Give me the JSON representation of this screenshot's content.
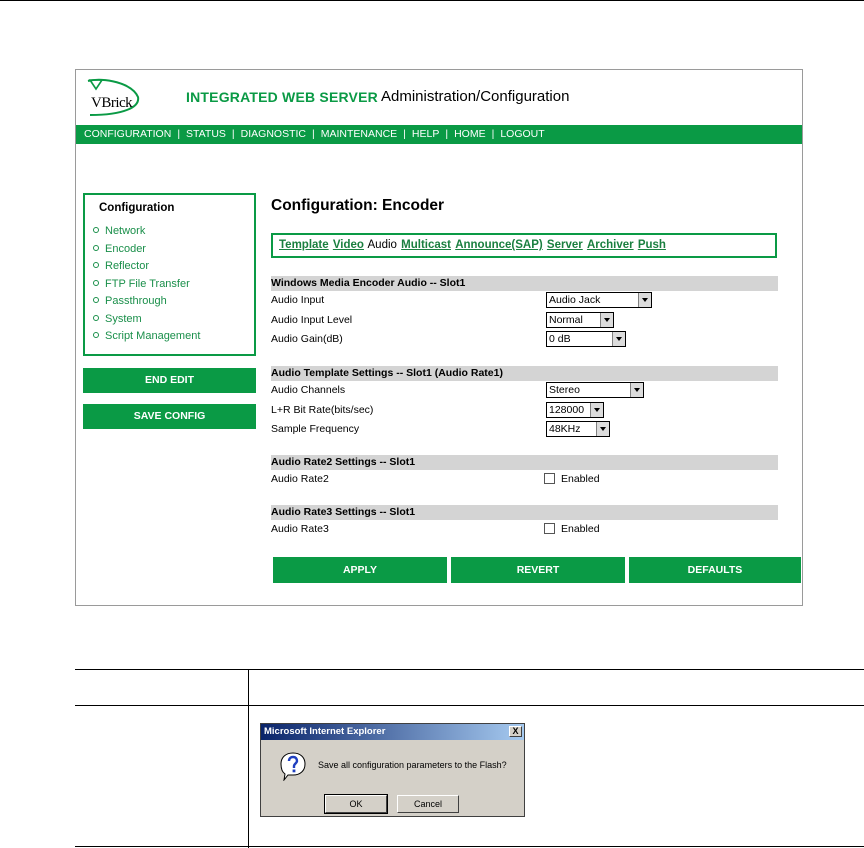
{
  "header": {
    "logo_text": "VBrick",
    "title": "INTEGRATED WEB SERVER",
    "subtitle": "Administration/Configuration"
  },
  "navbar": {
    "items": [
      "CONFIGURATION",
      "STATUS",
      "DIAGNOSTIC",
      "MAINTENANCE",
      "HELP",
      "HOME",
      "LOGOUT"
    ],
    "separator": "|"
  },
  "sidebar": {
    "heading": "Configuration",
    "items": [
      "Network",
      "Encoder",
      "Reflector",
      "FTP File Transfer",
      "Passthrough",
      "System",
      "Script Management"
    ],
    "end_edit_label": "END EDIT",
    "save_config_label": "SAVE CONFIG"
  },
  "main": {
    "title": "Configuration: Encoder",
    "tabs": [
      {
        "label": "Template",
        "active": false
      },
      {
        "label": "Video",
        "active": false
      },
      {
        "label": "Audio",
        "active": true
      },
      {
        "label": "Multicast",
        "active": false
      },
      {
        "label": "Announce(SAP)",
        "active": false
      },
      {
        "label": "Server",
        "active": false
      },
      {
        "label": "Archiver",
        "active": false
      },
      {
        "label": "Push",
        "active": false
      }
    ],
    "sections": {
      "wme_audio": {
        "heading": "Windows Media Encoder Audio -- Slot1",
        "audio_input_label": "Audio Input",
        "audio_input_value": "Audio Jack",
        "audio_input_level_label": "Audio Input Level",
        "audio_input_level_value": "Normal",
        "audio_gain_label": "Audio Gain(dB)",
        "audio_gain_value": "0 dB"
      },
      "template": {
        "heading": "Audio Template Settings -- Slot1 (Audio Rate1)",
        "channels_label": "Audio Channels",
        "channels_value": "Stereo",
        "bitrate_label": "L+R Bit Rate(bits/sec)",
        "bitrate_value": "128000",
        "sample_freq_label": "Sample Frequency",
        "sample_freq_value": "48KHz"
      },
      "rate2": {
        "heading": "Audio Rate2 Settings -- Slot1",
        "label": "Audio Rate2",
        "checkbox_label": "Enabled"
      },
      "rate3": {
        "heading": "Audio Rate3 Settings -- Slot1",
        "label": "Audio Rate3",
        "checkbox_label": "Enabled"
      }
    },
    "buttons": {
      "apply": "APPLY",
      "revert": "REVERT",
      "defaults": "DEFAULTS"
    }
  },
  "dialog": {
    "title": "Microsoft Internet Explorer",
    "close_glyph": "X",
    "message": "Save all configuration parameters to the Flash?",
    "ok_label": "OK",
    "cancel_label": "Cancel",
    "icon": "question-icon"
  },
  "colors": {
    "brand_green": "#0a9a45",
    "link_green": "#1a8f4a",
    "section_gray": "#d4d4d4",
    "dialog_face": "#d4d0c8",
    "titlebar_start": "#0a246a",
    "titlebar_end": "#a6caf0"
  }
}
